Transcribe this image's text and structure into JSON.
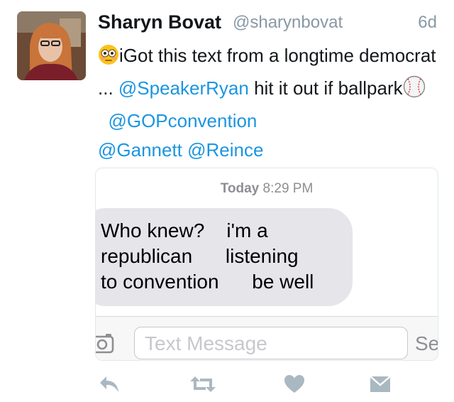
{
  "tweet": {
    "author_name": "Sharyn Bovat",
    "author_handle": "@sharynbovat",
    "time_ago": "6d",
    "text_part1": "iGot this text from a longtime democrat ... ",
    "mention1": "@SpeakerRyan",
    "text_part2": " hit it out if ballpark",
    "mention2": "@GOPconvention",
    "mention3": "@Gannett",
    "mention4": "@Reince"
  },
  "media": {
    "stamp_day": "Today",
    "stamp_time": "8:29 PM",
    "message_lines": [
      "Who knew?    i'm a",
      "republican      listening",
      "to convention      be well"
    ],
    "composer_placeholder": "Text Message",
    "send_label": "Se"
  },
  "actions": [
    "reply-icon",
    "retweet-icon",
    "like-icon",
    "direct-message-icon"
  ],
  "colors": {
    "link": "#1b95e0",
    "muted": "#8899a6",
    "action": "#aab8c2",
    "bubble": "#e5e5ea"
  }
}
